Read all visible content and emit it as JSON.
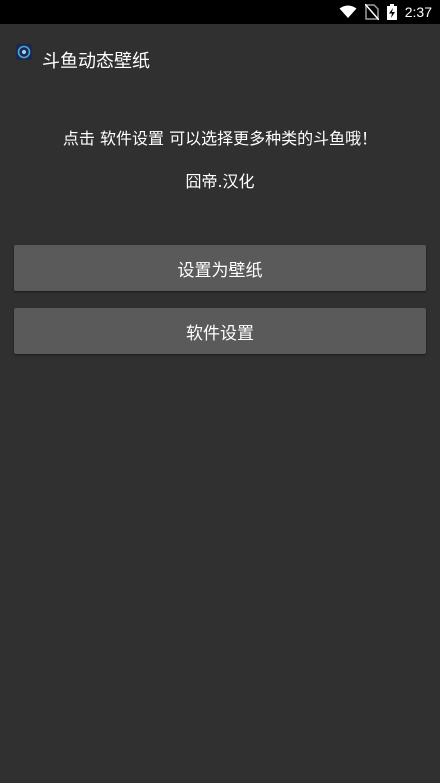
{
  "status_bar": {
    "time": "2:37",
    "icons": [
      "wifi-icon",
      "no-sim-icon",
      "battery-charging-icon"
    ]
  },
  "app": {
    "title": "斗鱼动态壁纸",
    "icon": "app-logo-icon"
  },
  "main": {
    "hint": "点击 软件设置 可以选择更多种类的斗鱼哦！",
    "credit": "囧帝.汉化",
    "set_wallpaper_label": "设置为壁纸",
    "settings_label": "软件设置"
  },
  "colors": {
    "background": "#303030",
    "status_bar": "#000000",
    "button": "#5a5a5a",
    "text": "#ffffff"
  }
}
